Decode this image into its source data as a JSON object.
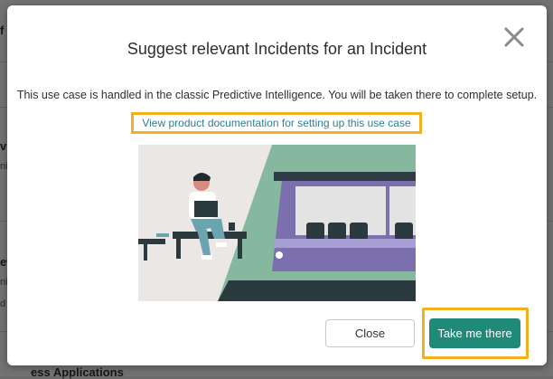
{
  "background": {
    "fragments": [
      "f",
      "vi",
      "ni",
      "ew",
      "ni",
      "d",
      "ess Applications"
    ]
  },
  "modal": {
    "title": "Suggest relevant Incidents for an Incident",
    "close_icon": "close-x-icon",
    "message": "This use case is handled in the classic Predictive Intelligence. You will be taken there to complete setup.",
    "doc_link": "View product documentation for setting up this use case",
    "illustration": "person-with-laptop-and-train",
    "buttons": {
      "close_label": "Close",
      "primary_label": "Take me there"
    }
  },
  "colors": {
    "primary": "#1f8a78",
    "highlight": "#f2b01e",
    "link": "#2f7f8f"
  }
}
